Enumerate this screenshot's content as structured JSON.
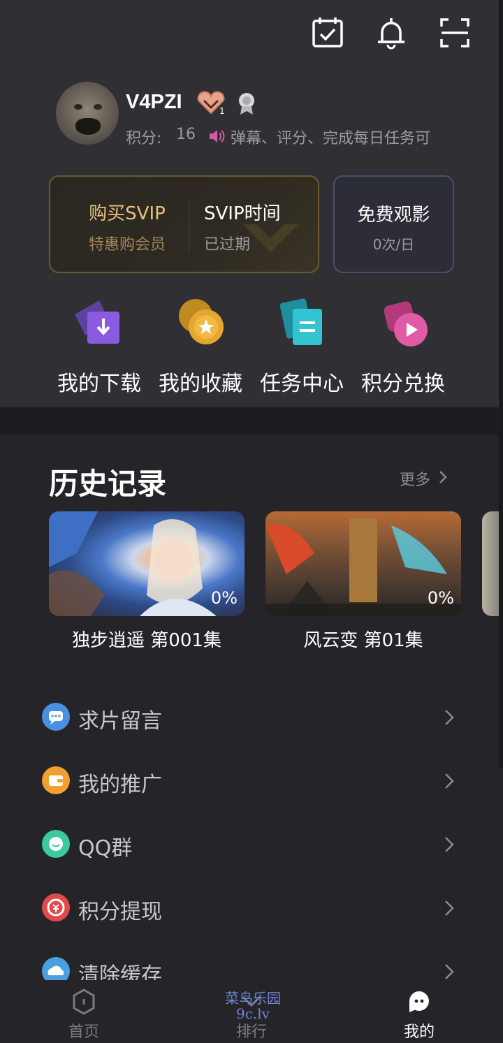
{
  "header": {
    "icons": [
      "calendar-check-icon",
      "bell-icon",
      "scan-icon"
    ]
  },
  "profile": {
    "username": "V4PZI",
    "points_label": "积分:",
    "points_value": "16",
    "marquee": "弹幕、评分、完成每日任务可"
  },
  "svip": {
    "buy_title": "购买SVIP",
    "buy_sub": "特惠购会员",
    "time_title": "SVIP时间",
    "time_sub": "已过期",
    "free_title": "免费观影",
    "free_sub": "0次/日"
  },
  "quick_actions": [
    {
      "label": "我的下载",
      "icon": "download-icon",
      "color": "#7b4fd1"
    },
    {
      "label": "我的收藏",
      "icon": "star-icon",
      "color": "#e0a12a"
    },
    {
      "label": "任务中心",
      "icon": "task-list-icon",
      "color": "#2ab7c4"
    },
    {
      "label": "积分兑换",
      "icon": "play-icon",
      "color": "#d64a9a"
    }
  ],
  "history": {
    "title": "历史记录",
    "more": "更多",
    "items": [
      {
        "title": "独步逍遥 第001集",
        "progress": "0%"
      },
      {
        "title": "风云变 第01集",
        "progress": "0%"
      }
    ]
  },
  "menu": [
    {
      "label": "求片留言",
      "icon": "chat-bubble-icon",
      "color": "#4a90e2"
    },
    {
      "label": "我的推广",
      "icon": "wallet-icon",
      "color": "#f0a030"
    },
    {
      "label": "QQ群",
      "icon": "qq-group-icon",
      "color": "#3cc8a0"
    },
    {
      "label": "积分提现",
      "icon": "withdraw-icon",
      "color": "#e04a4a"
    },
    {
      "label": "清除缓存",
      "icon": "cloud-icon",
      "color": "#4aa0e0"
    }
  ],
  "tabs": [
    {
      "label": "首页",
      "icon": "home-icon",
      "active": false
    },
    {
      "label": "排行",
      "icon": "ranking-icon",
      "active": false
    },
    {
      "label": "我的",
      "icon": "profile-bubble-icon",
      "active": true
    }
  ],
  "watermark": {
    "line1": "菜鸟乐园",
    "line2": "9c.lv"
  },
  "colors": {
    "gold": "#e8c27a",
    "gold_sub": "#a08656",
    "text_muted": "#9a9aa0",
    "background": "#252429",
    "card": "#2f2f34"
  }
}
